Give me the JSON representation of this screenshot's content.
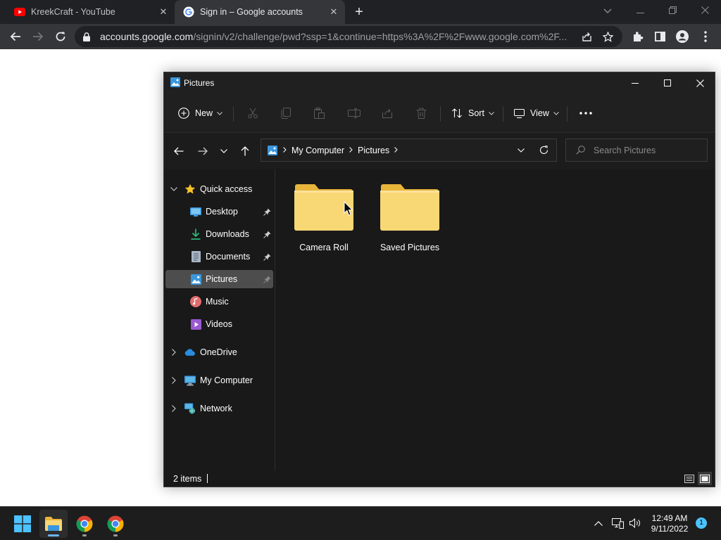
{
  "browser": {
    "tabs": [
      {
        "title": "KreekCraft - YouTube",
        "favicon": "youtube-icon",
        "active": false
      },
      {
        "title": "Sign in – Google accounts",
        "favicon": "google-icon",
        "active": true
      }
    ],
    "url_domain": "accounts.google.com",
    "url_path": "/signin/v2/challenge/pwd?ssp=1&continue=https%3A%2F%2Fwww.google.com%2F..."
  },
  "explorer": {
    "window_title": "Pictures",
    "commands": {
      "new_label": "New",
      "sort_label": "Sort",
      "view_label": "View"
    },
    "breadcrumb": [
      "My Computer",
      "Pictures"
    ],
    "search_placeholder": "Search Pictures",
    "nav": {
      "quick_access": "Quick access",
      "desktop": "Desktop",
      "downloads": "Downloads",
      "documents": "Documents",
      "pictures": "Pictures",
      "music": "Music",
      "videos": "Videos",
      "onedrive": "OneDrive",
      "my_computer": "My Computer",
      "network": "Network"
    },
    "folders": [
      {
        "name": "Camera Roll"
      },
      {
        "name": "Saved Pictures"
      }
    ],
    "status": {
      "items": "2 items"
    }
  },
  "taskbar": {
    "time": "12:49 AM",
    "date": "9/11/2022",
    "notifications": "1"
  },
  "colors": {
    "accent": "#4cc2ff",
    "folder": "#f8d775",
    "folder_tab": "#e8b53a"
  }
}
